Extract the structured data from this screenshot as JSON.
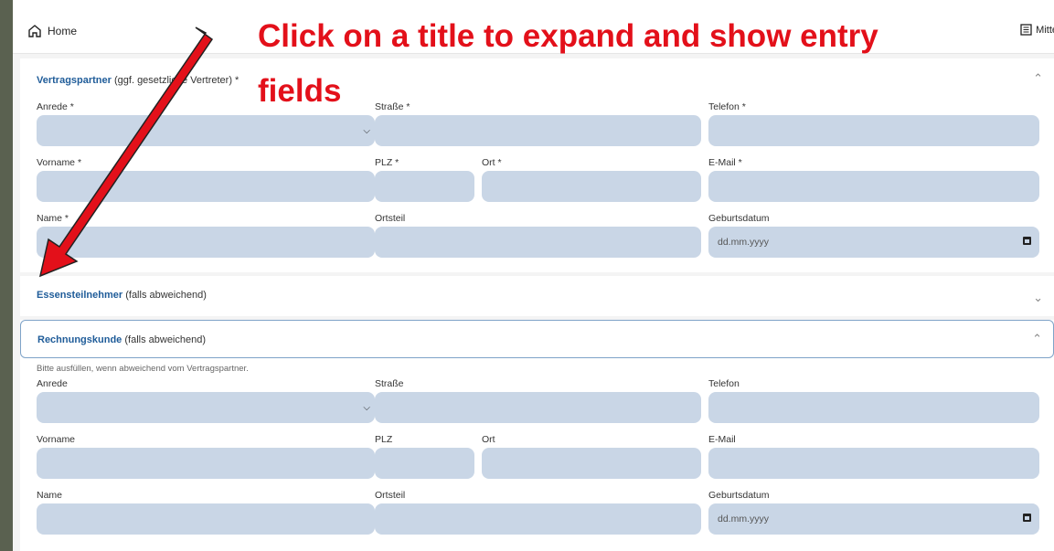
{
  "topbar": {
    "home_label": "Home",
    "right_label": "Mitte"
  },
  "section1": {
    "title": "Vertragspartner",
    "subtitle": "(ggf. gesetzliche Vertreter) *",
    "labels": {
      "anrede": "Anrede *",
      "strasse": "Straße *",
      "telefon": "Telefon *",
      "vorname": "Vorname *",
      "plz": "PLZ *",
      "ort": "Ort *",
      "email": "E-Mail *",
      "name": "Name *",
      "ortsteil": "Ortsteil",
      "geburtsdatum": "Geburtsdatum"
    },
    "date_placeholder": "dd.mm.yyyy"
  },
  "section2": {
    "title": "Essensteilnehmer",
    "subtitle": "(falls abweichend)"
  },
  "section3": {
    "title": "Rechnungskunde",
    "subtitle": "(falls abweichend)",
    "hint": "Bitte ausfüllen, wenn abweichend vom Vertragspartner.",
    "labels": {
      "anrede": "Anrede",
      "strasse": "Straße",
      "telefon": "Telefon",
      "vorname": "Vorname",
      "plz": "PLZ",
      "ort": "Ort",
      "email": "E-Mail",
      "name": "Name",
      "ortsteil": "Ortsteil",
      "geburtsdatum": "Geburtsdatum"
    },
    "date_placeholder": "dd.mm.yyyy"
  },
  "annotation": {
    "line1": "Click on a title to expand and show entry",
    "line2": "fields",
    "color": "#e3101a"
  },
  "icons": {
    "home": "home-icon",
    "right": "document-icon",
    "expanded": "chevron-up-icon",
    "collapsed": "chevron-down-icon"
  }
}
